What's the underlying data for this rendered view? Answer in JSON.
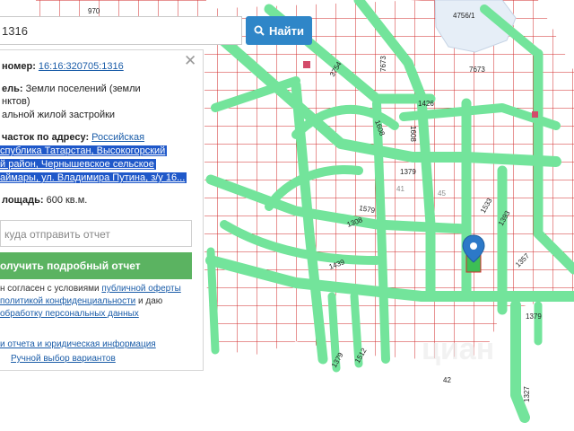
{
  "search": {
    "query": "1316",
    "button_label": "Найти"
  },
  "panel": {
    "cad_label": "номер:",
    "cad_value": "16:16:320705:1316",
    "purpose_label": "ель:",
    "purpose_value_1": "Земли поселений (земли",
    "purpose_value_2": "нктов)",
    "purpose_value_3": "альной жилой застройки",
    "address_label": "часток по адресу:",
    "address_lines": [
      "Российская",
      "спублика Татарстан, Высокогорский",
      "й район, Чернышевское сельское",
      "аймары, ул. Владимира Путина, з/у 16..."
    ],
    "area_label": "лощадь:",
    "area_value": "600 кв.м.",
    "email_placeholder": "куда отправить отчет",
    "report_button": "олучить подробный отчет",
    "agree_1": "н согласен с условиями",
    "agree_1_link": "публичной оферты",
    "agree_2_link": "политикой конфиденциальности",
    "agree_2_tail": "и даю",
    "agree_3_link": "обработку персональных данных",
    "footer_link_1": "и отчета и юридическая информация",
    "footer_link_2": "Ручной выбор вариантов"
  },
  "map": {
    "labels": {
      "l970": "970",
      "l4756": "4756/1",
      "l7673a": "7673",
      "l7673b": "7673",
      "l3754": "3754",
      "l1426": "1426",
      "l1608a": "1608",
      "l1608b": "1608",
      "l1379a": "1379",
      "l41": "41",
      "l45": "45",
      "l1579": "1579",
      "l1308": "1308",
      "l1533": "1533",
      "l1393": "1393",
      "l1439": "1439",
      "l1357": "1357",
      "l1379b": "1379",
      "l1379c": "1379",
      "l1512": "1512",
      "l42": "42",
      "l1327": "1327"
    },
    "colors": {
      "road": "#73e49b",
      "parcel_border": "#d22a2a",
      "water": "#e6eef7",
      "marker": "#2c79c8",
      "selected_parcel": "#3dbf55"
    }
  }
}
